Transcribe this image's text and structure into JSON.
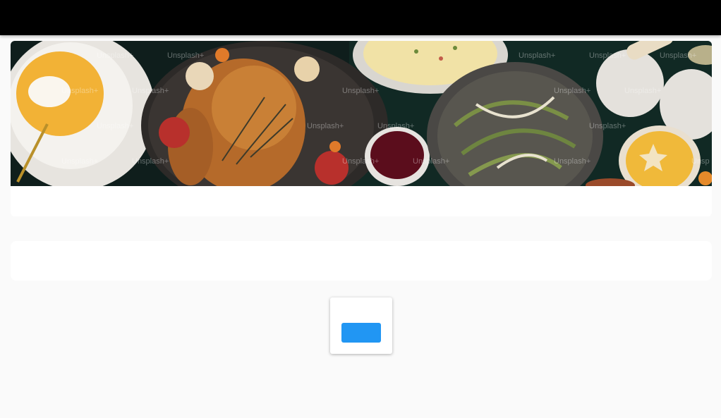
{
  "colors": {
    "app_bar": "#000000",
    "page_background": "#fafafa",
    "card_background": "#ffffff",
    "primary_button": "#2196f3"
  },
  "hero": {
    "image_subject": "food spread: pumpkin soup, roast chicken, mashed potatoes, cranberry sauce, green beans, pumpkin pie",
    "watermark": "Unsplash+"
  },
  "action": {
    "button_label": ""
  }
}
